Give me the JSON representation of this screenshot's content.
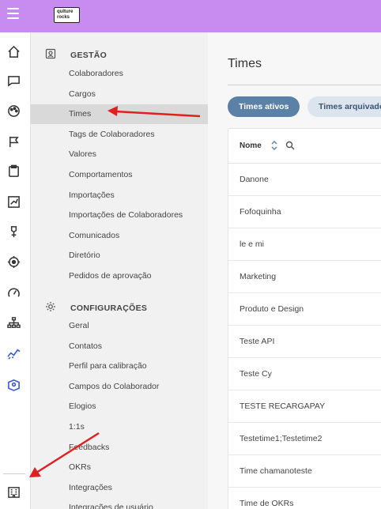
{
  "logo": {
    "line1": "qulture",
    "line2": "rocks"
  },
  "rail": [
    "home-icon",
    "chat-icon",
    "palette-icon",
    "flag-icon",
    "clipboard-icon",
    "edit-chart-icon",
    "award-icon",
    "target-icon",
    "gauge-icon",
    "org-chart-icon",
    "analytics-icon",
    "learning-icon",
    "building-icon"
  ],
  "menu": {
    "gestao": {
      "title": "GESTÃO",
      "items": [
        "Colaboradores",
        "Cargos",
        "Times",
        "Tags de Colaboradores",
        "Valores",
        "Comportamentos",
        "Importações",
        "Importações de Colaboradores",
        "Comunicados",
        "Diretório",
        "Pedidos de aprovação"
      ]
    },
    "config": {
      "title": "CONFIGURAÇÕES",
      "items": [
        "Geral",
        "Contatos",
        "Perfil para calibração",
        "Campos do Colaborador",
        "Elogios",
        "1:1s",
        "Feedbacks",
        "OKRs",
        "Integrações",
        "Integrações de usuário"
      ]
    },
    "active_item": "Times"
  },
  "main": {
    "title": "Times",
    "tabs": [
      "Times ativos",
      "Times arquivados"
    ],
    "column": "Nome",
    "rows": [
      "Danone",
      "Fofoquinha",
      "le e mi",
      "Marketing",
      "Produto e Design",
      "Teste API",
      "Teste Cy",
      "TESTE RECARGAPAY",
      "Testetime1;Testetime2",
      "Time chamanoteste",
      "Time de OKRs"
    ]
  },
  "colors": {
    "topbar": "#c88cf0",
    "active_tab": "#5b81a6",
    "annotation_arrow": "#e02020"
  }
}
